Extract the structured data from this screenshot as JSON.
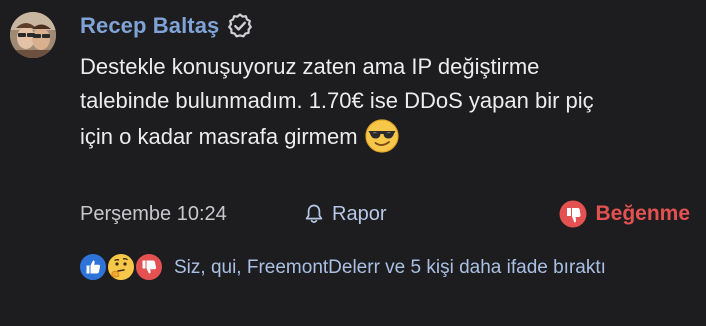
{
  "post": {
    "author": {
      "name": "Recep Baltaş",
      "verified": true
    },
    "body_lines": [
      "Destekle konuşuyoruz zaten ama IP değiştirme",
      "talebinde bulunmadım. 1.70€ ise DDoS yapan bir piç",
      "için o kadar masrafa girmem"
    ],
    "emoji": "smiling-face-with-sunglasses-icon",
    "timestamp": "Perşembe 10:24",
    "report_label": "Rapor",
    "dislike_label": "Beğenme",
    "reactions": {
      "icons": [
        "thumbs-up-icon",
        "thinking-face-icon",
        "thumbs-down-icon"
      ],
      "summary": "Siz, qui, FreemontDelerr ve 5 kişi daha ifade bıraktı"
    }
  },
  "colors": {
    "background": "#1d1d1f",
    "author": "#7fa3d6",
    "text": "#ececec",
    "meta": "#c8c8cc",
    "link": "#b7c7e6",
    "dislike": "#e45151",
    "like_blue": "#2d73d8"
  }
}
